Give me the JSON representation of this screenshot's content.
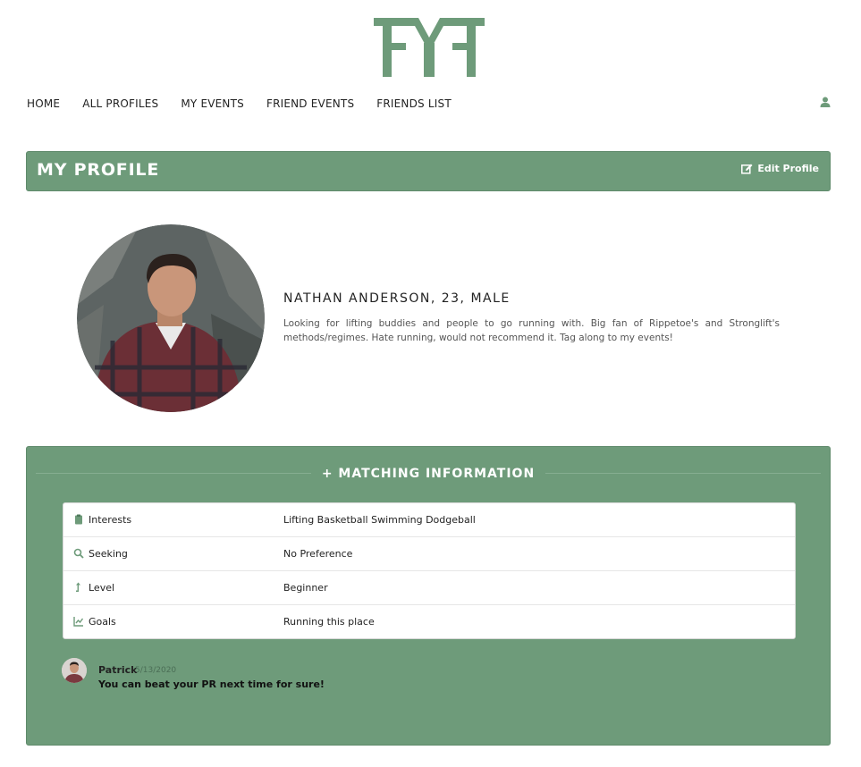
{
  "brand": {
    "logo_text": "FMF",
    "accent_color": "#6e9b7a"
  },
  "nav": {
    "items": [
      {
        "label": "HOME"
      },
      {
        "label": "ALL PROFILES"
      },
      {
        "label": "MY EVENTS"
      },
      {
        "label": "FRIEND EVENTS"
      },
      {
        "label": "FRIENDS LIST"
      }
    ],
    "user_icon": "user-icon"
  },
  "header": {
    "title": "MY PROFILE",
    "edit_label": "Edit Profile",
    "edit_icon": "edit-icon"
  },
  "profile": {
    "name_line": "NATHAN ANDERSON, 23, MALE",
    "bio": "Looking for lifting buddies and people to go running with. Big fan of Rippetoe's and Stronglift's methods/regimes. Hate running, would not recommend it. Tag along to my events!"
  },
  "matching": {
    "title": "+ MATCHING INFORMATION",
    "rows": [
      {
        "icon": "clipboard-icon",
        "label": "Interests",
        "value": "Lifting Basketball Swimming Dodgeball"
      },
      {
        "icon": "search-icon",
        "label": "Seeking",
        "value": "No Preference"
      },
      {
        "icon": "level-up-icon",
        "label": "Level",
        "value": "Beginner"
      },
      {
        "icon": "chart-icon",
        "label": "Goals",
        "value": "Running this place"
      }
    ]
  },
  "comment": {
    "author": "Patrick",
    "date": "5/13/2020",
    "text": "You can beat your PR next time for sure!"
  }
}
